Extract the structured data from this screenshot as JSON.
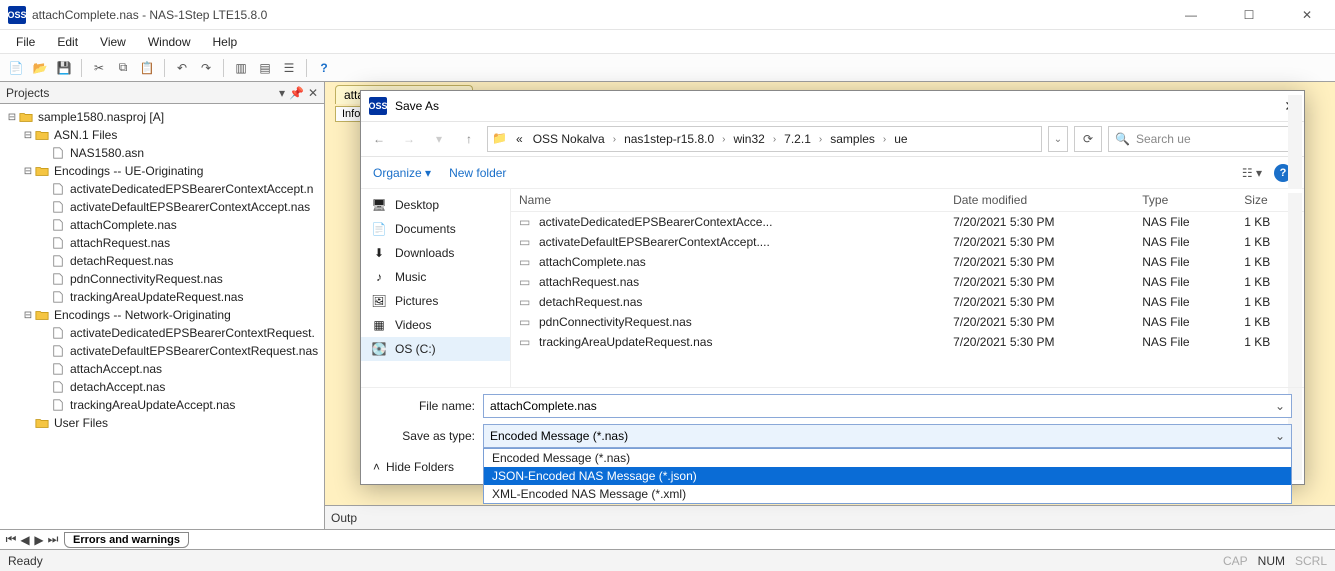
{
  "window": {
    "title": "attachComplete.nas - NAS-1Step LTE15.8.0",
    "app_badge": "OSS"
  },
  "menu": [
    "File",
    "Edit",
    "View",
    "Window",
    "Help"
  ],
  "panels": {
    "projects_title": "Projects",
    "output_title": "Outp",
    "errors_tab": "Errors and warnings",
    "info_tab": "Info"
  },
  "tree": {
    "root": "sample1580.nasproj [A]",
    "asn1_folder": "ASN.1 Files",
    "asn1_file": "NAS1580.asn",
    "enc1": "Encodings -- UE-Originating",
    "enc1_files": [
      "activateDedicatedEPSBearerContextAccept.n",
      "activateDefaultEPSBearerContextAccept.nas",
      "attachComplete.nas",
      "attachRequest.nas",
      "detachRequest.nas",
      "pdnConnectivityRequest.nas",
      "trackingAreaUpdateRequest.nas"
    ],
    "enc2": "Encodings -- Network-Originating",
    "enc2_files": [
      "activateDedicatedEPSBearerContextRequest.",
      "activateDefaultEPSBearerContextRequest.nas",
      "attachAccept.nas",
      "detachAccept.nas",
      "trackingAreaUpdateAccept.nas"
    ],
    "user_files": "User Files"
  },
  "editor_tab": {
    "label": "attachComplete.nas",
    "close_glyph": "×"
  },
  "status": {
    "left": "Ready",
    "caps": "CAP",
    "num": "NUM",
    "scrl": "SCRL"
  },
  "dialog": {
    "title": "Save As",
    "app_badge": "OSS",
    "crumb_prefix": "«",
    "crumbs": [
      "OSS Nokalva",
      "nas1step-r15.8.0",
      "win32",
      "7.2.1",
      "samples",
      "ue"
    ],
    "search_placeholder": "Search ue",
    "organize": "Organize",
    "new_folder": "New folder",
    "sidebar": [
      {
        "icon": "desktop",
        "label": "Desktop"
      },
      {
        "icon": "doc",
        "label": "Documents"
      },
      {
        "icon": "download",
        "label": "Downloads"
      },
      {
        "icon": "music",
        "label": "Music"
      },
      {
        "icon": "picture",
        "label": "Pictures"
      },
      {
        "icon": "video",
        "label": "Videos"
      },
      {
        "icon": "disk",
        "label": "OS (C:)",
        "selected": true
      }
    ],
    "columns": [
      "Name",
      "Date modified",
      "Type",
      "Size"
    ],
    "files": [
      {
        "name": "activateDedicatedEPSBearerContextAcce...",
        "date": "7/20/2021 5:30 PM",
        "type": "NAS File",
        "size": "1 KB"
      },
      {
        "name": "activateDefaultEPSBearerContextAccept....",
        "date": "7/20/2021 5:30 PM",
        "type": "NAS File",
        "size": "1 KB"
      },
      {
        "name": "attachComplete.nas",
        "date": "7/20/2021 5:30 PM",
        "type": "NAS File",
        "size": "1 KB"
      },
      {
        "name": "attachRequest.nas",
        "date": "7/20/2021 5:30 PM",
        "type": "NAS File",
        "size": "1 KB"
      },
      {
        "name": "detachRequest.nas",
        "date": "7/20/2021 5:30 PM",
        "type": "NAS File",
        "size": "1 KB"
      },
      {
        "name": "pdnConnectivityRequest.nas",
        "date": "7/20/2021 5:30 PM",
        "type": "NAS File",
        "size": "1 KB"
      },
      {
        "name": "trackingAreaUpdateRequest.nas",
        "date": "7/20/2021 5:30 PM",
        "type": "NAS File",
        "size": "1 KB"
      }
    ],
    "file_name_label": "File name:",
    "file_name_value": "attachComplete.nas",
    "save_type_label": "Save as type:",
    "save_type_value": "Encoded Message (*.nas)",
    "type_options": [
      "Encoded Message (*.nas)",
      "JSON-Encoded NAS Message (*.json)",
      "XML-Encoded NAS Message (*.xml)"
    ],
    "type_selected_index": 1,
    "hide_folders": "Hide Folders"
  }
}
